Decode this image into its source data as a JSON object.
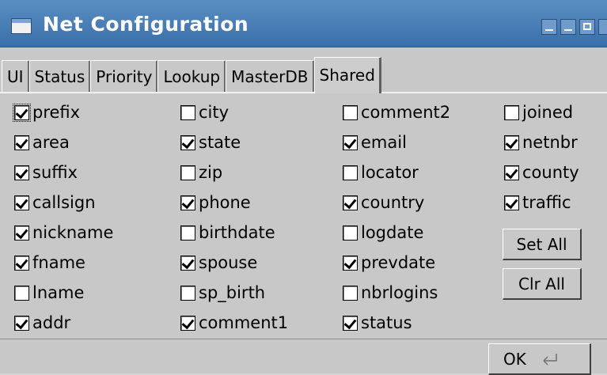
{
  "window": {
    "title": "Net Configuration"
  },
  "tabs": [
    "UI",
    "Status",
    "Priority",
    "Lookup",
    "MasterDB",
    "Shared"
  ],
  "active_tab": "Shared",
  "columns": [
    [
      {
        "label": "prefix",
        "checked": true
      },
      {
        "label": "area",
        "checked": true
      },
      {
        "label": "suffix",
        "checked": true
      },
      {
        "label": "callsign",
        "checked": true
      },
      {
        "label": "nickname",
        "checked": true
      },
      {
        "label": "fname",
        "checked": true
      },
      {
        "label": "lname",
        "checked": false
      },
      {
        "label": "addr",
        "checked": true
      }
    ],
    [
      {
        "label": "city",
        "checked": false
      },
      {
        "label": "state",
        "checked": true
      },
      {
        "label": "zip",
        "checked": false
      },
      {
        "label": "phone",
        "checked": true
      },
      {
        "label": "birthdate",
        "checked": false
      },
      {
        "label": "spouse",
        "checked": true
      },
      {
        "label": "sp_birth",
        "checked": false
      },
      {
        "label": "comment1",
        "checked": true
      }
    ],
    [
      {
        "label": "comment2",
        "checked": false
      },
      {
        "label": "email",
        "checked": true
      },
      {
        "label": "locator",
        "checked": false
      },
      {
        "label": "country",
        "checked": true
      },
      {
        "label": "logdate",
        "checked": false
      },
      {
        "label": "prevdate",
        "checked": true
      },
      {
        "label": "nbrlogins",
        "checked": false
      },
      {
        "label": "status",
        "checked": true
      }
    ],
    [
      {
        "label": "joined",
        "checked": false
      },
      {
        "label": "netnbr",
        "checked": true
      },
      {
        "label": "county",
        "checked": true
      },
      {
        "label": "traffic",
        "checked": true
      }
    ]
  ],
  "buttons": {
    "set_all": "Set All",
    "clr_all": "Clr All",
    "ok": "OK"
  },
  "icons": {
    "ok": "enter-arrow-icon",
    "window": "window-icon"
  },
  "colors": {
    "titlebar": "#4a7fb8",
    "background": "#c8c8c8"
  }
}
